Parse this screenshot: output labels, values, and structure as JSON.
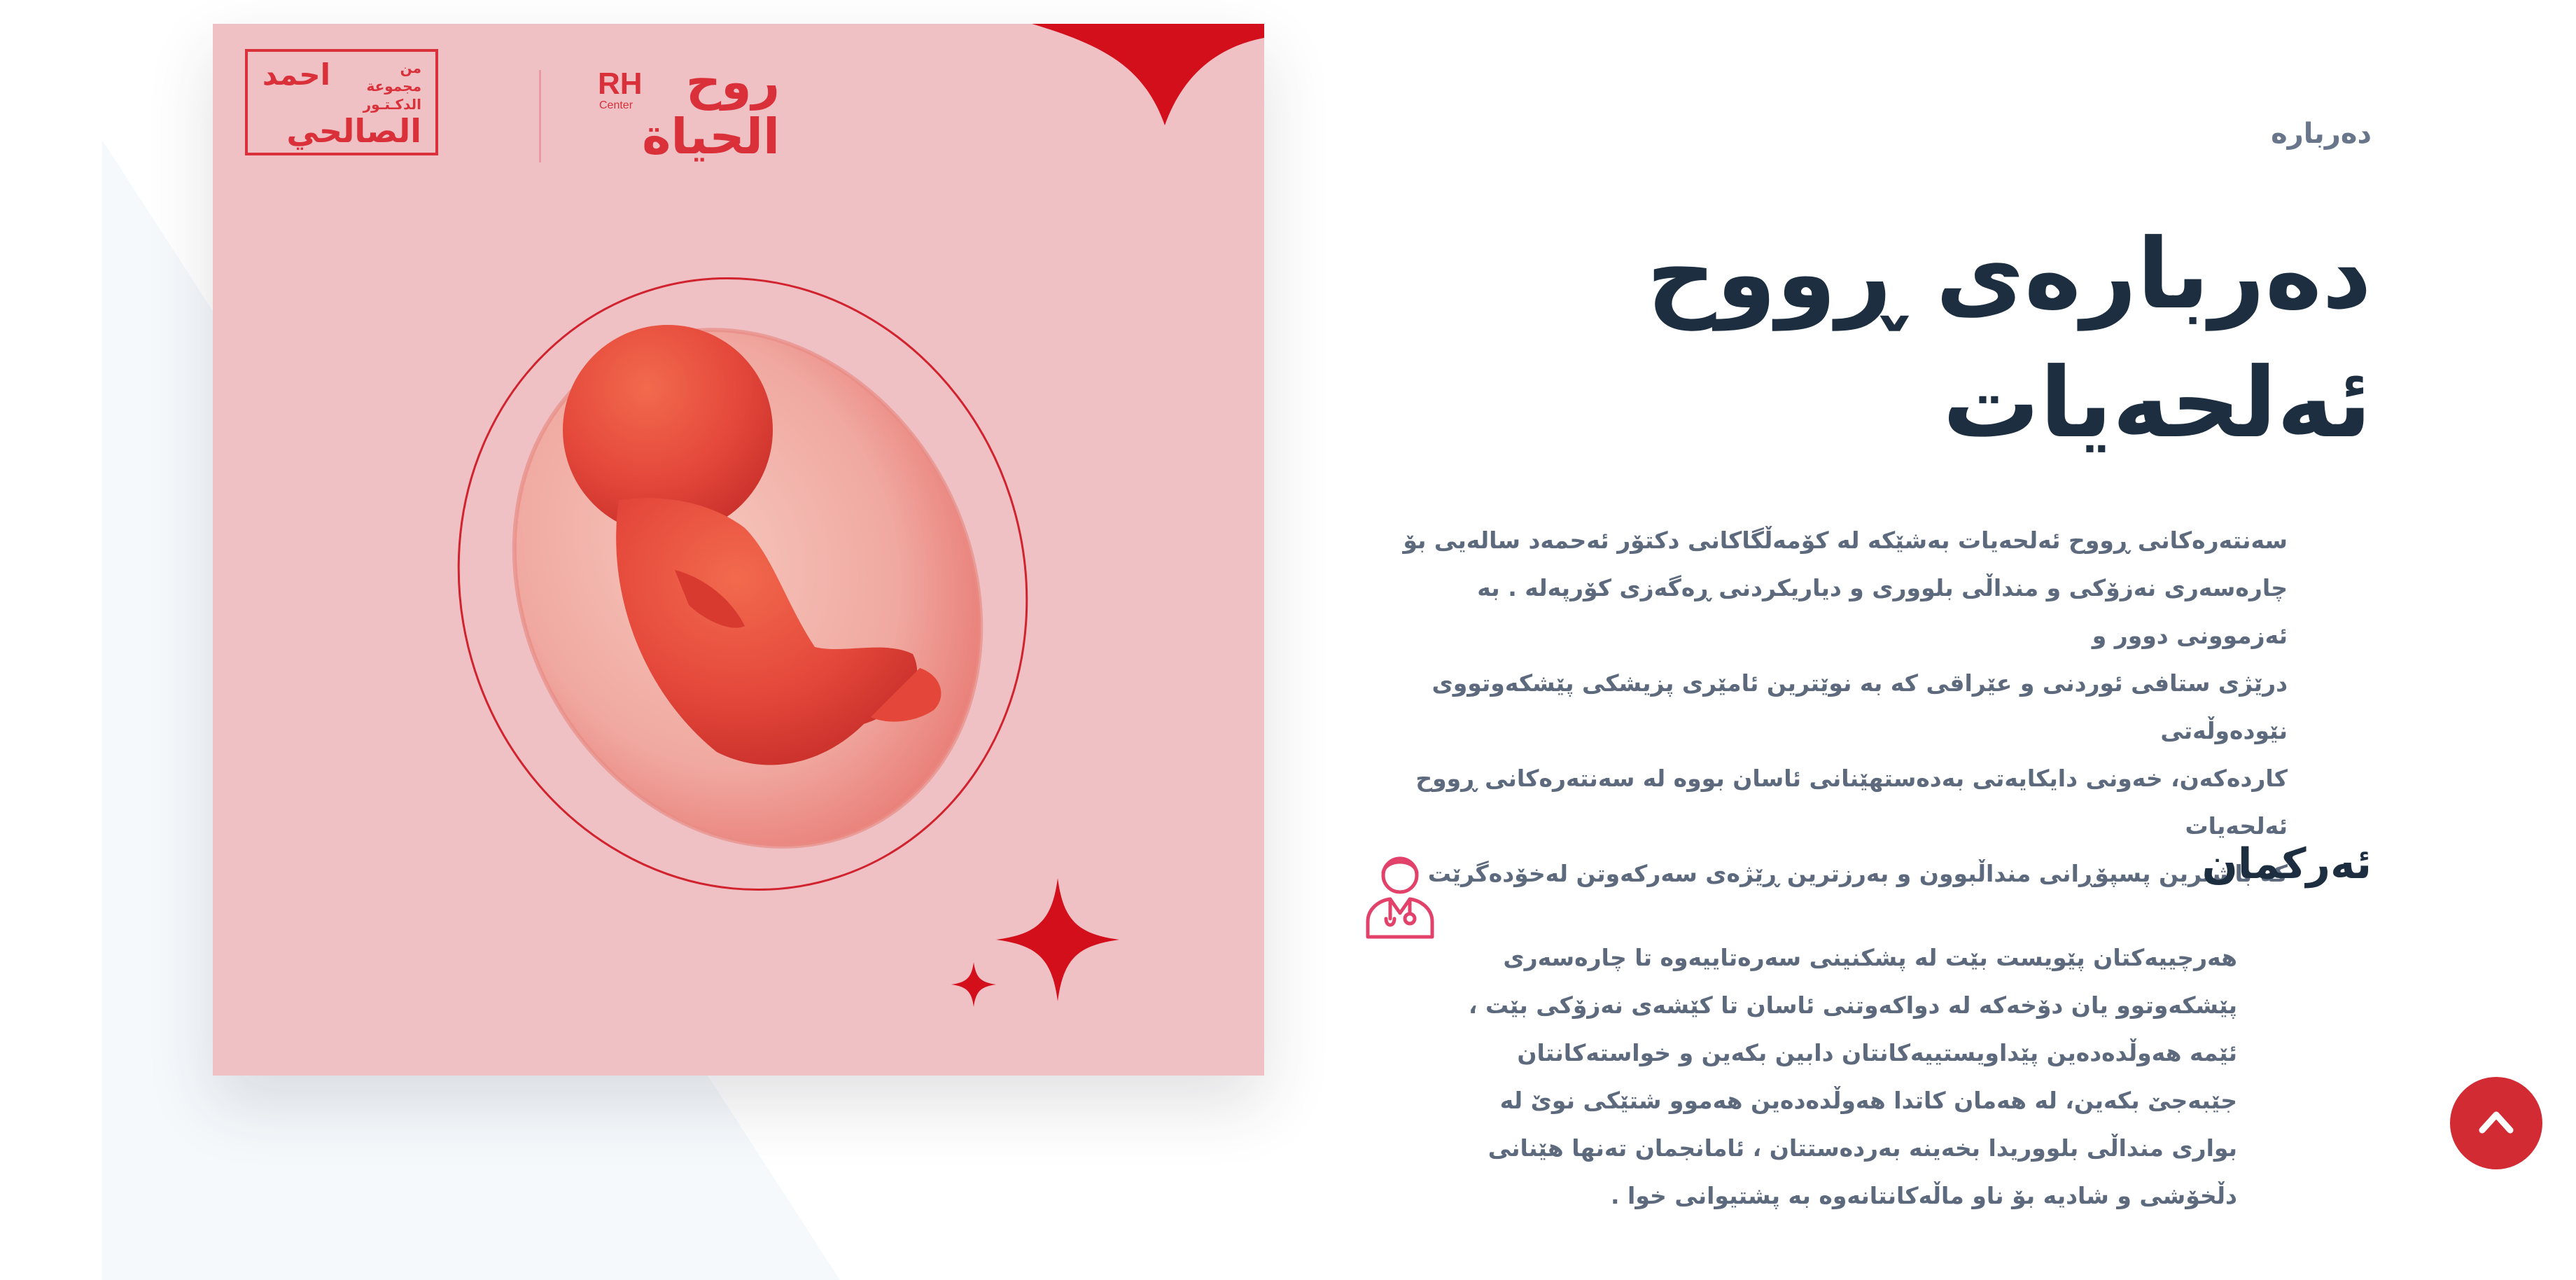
{
  "image_card": {
    "logo_left": {
      "line1": "من مجموعة",
      "line2": "الدكـتـور",
      "line3": "احمد",
      "line4": "الصالحي"
    },
    "logo_right": {
      "rh": "RH",
      "center": "Center",
      "name_line1": "روح",
      "name_line2": "الحياة"
    },
    "colors": {
      "card_bg": "#efc1c5",
      "accent_red": "#d9303a",
      "star_red": "#d40f1c"
    }
  },
  "about": {
    "eyebrow": "دەربارە",
    "title_line1": "دەربارەی ڕووح",
    "title_line2": "ئەلحەیات",
    "intro_lines": [
      "سەنتەرەکانی ڕووح ئەلحەیات بەشێکە لە کۆمەڵگاکانی  دکتۆر ئەحمەد سالەیی بۆ",
      "چارەسەری نەزۆکی و منداڵی بلووری و دیاریکردنی ڕەگەزی کۆرپەلە . بە ئەزموونی دوور و",
      "درێژی ستافی ئوردنی و عێراقی کە بە نوێترین ئامێری پزیشکی پێشکەوتووی نێودەوڵەتی",
      "کاردەکەن، خەونی دایکایەتی  بەدەستهێنانی ئاسان بووە  لە سەنتەرەکانی ڕووح ئەلحەیات",
      "کە باشترین پسپۆڕانی منداڵبوون و بەرزترین ڕێژەی سەرکەوتن لەخۆدەگرێت"
    ]
  },
  "duties": {
    "heading": "ئەرکمان",
    "icon": "doctor-icon",
    "lines": [
      "هەرچییەکتان پێویست بێت لە پشکنینی سەرەتاییەوە تا چارەسەری",
      "پێشکەوتوو یان دۆخەکە لە دواکەوتنی ئاسان  تا کێشەی نەزۆکی بێت ،",
      "ئێمە هەوڵدەدەین پێداویستییەکانتان دابین بکەین و خواستەکانتان",
      "جێبەجێ بکەین، لە هەمان کاتدا هەوڵدەدەین هەموو شتێکی نوێ لە",
      "بواری منداڵی بلووریدا  بخەینە بەردەستتان ، ئامانجمان تەنها هێنانی",
      "دڵخۆشی و شادیە بۆ ناو ماڵەکانتانەوە بە پشتیوانی خوا ."
    ]
  },
  "controls": {
    "scroll_top_icon": "chevron-up-icon",
    "scroll_top_color": "#d22b34"
  },
  "theme": {
    "heading_color": "#1c2e40",
    "body_text_color": "#5d6a7e",
    "eyebrow_color": "#68758a"
  }
}
